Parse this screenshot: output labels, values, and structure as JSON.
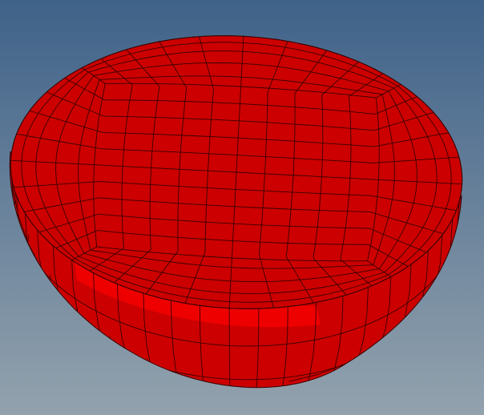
{
  "viewport": {
    "background_top_color": "#3f6289",
    "background_bottom_color": "#93a2ad"
  },
  "model": {
    "shape": "hemisphere",
    "element_type": "hexahedral-mesh",
    "mesh_style": "o-grid",
    "face_color": "#cc0000",
    "highlight_color": "#ee0000",
    "edge_color": "#3a0000"
  }
}
